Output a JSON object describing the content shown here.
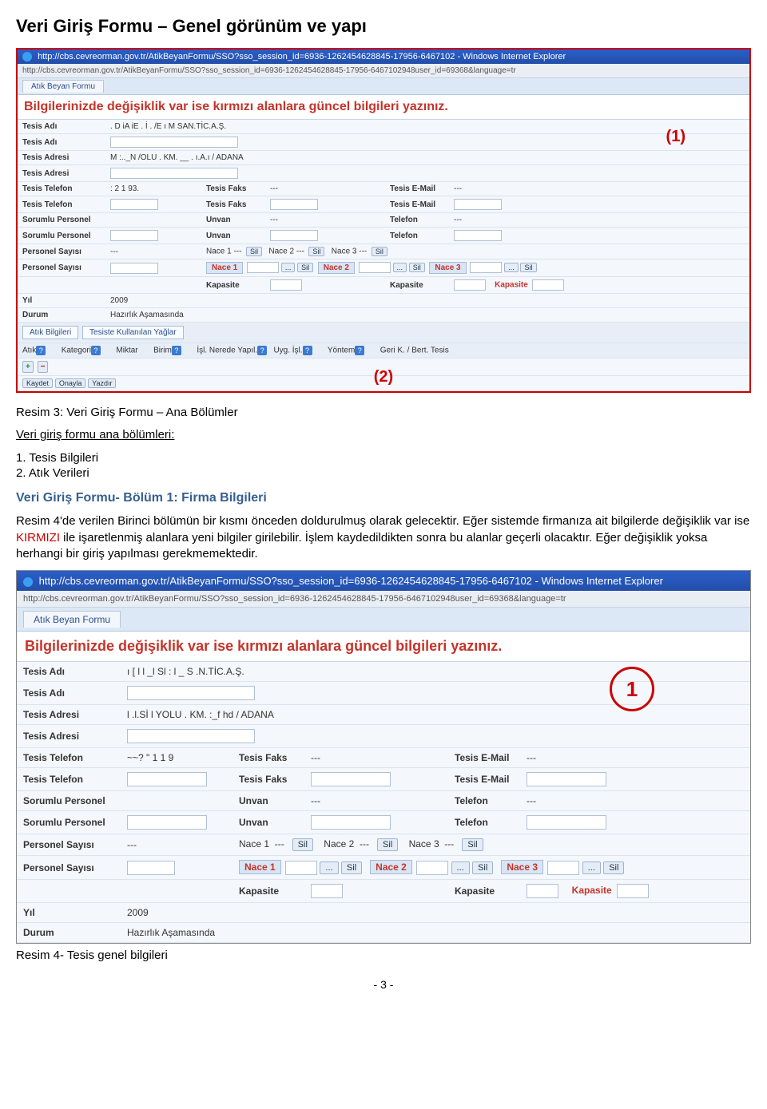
{
  "page": {
    "title": "Veri Giriş Formu – Genel görünüm ve yapı",
    "caption3": "Resim 3: Veri Giriş Formu – Ana Bölümler",
    "intro_sections": "Veri giriş formu ana bölümleri:",
    "sections": [
      "1. Tesis Bilgileri",
      "2. Atık Verileri"
    ],
    "h2": "Veri Giriş Formu- Bölüm 1: Firma Bilgileri",
    "para": {
      "p1a": "Resim 4'de verilen Birinci bölümün bir kısmı önceden doldurulmuş olarak gelecektir. Eğer sistemde firmanıza ait bilgilerde değişiklik var ise ",
      "p1_red": "KIRMIZI",
      "p1b": " ile işaretlenmiş alanlara yeni bilgiler girilebilir. İşlem kaydedildikten sonra bu alanlar geçerli olacaktır. Eğer değişiklik yoksa herhangi bir giriş yapılması gerekmemektedir."
    },
    "caption4": "Resim 4- Tesis genel bilgileri",
    "page_no": "- 3 -"
  },
  "markers": {
    "m1": "(1)",
    "m2": "(2)",
    "circle": "1"
  },
  "ie": {
    "title": "http://cbs.cevreorman.gov.tr/AtikBeyanFormu/SSO?sso_session_id=6936-1262454628845-17956-6467102 - Windows Internet Explorer",
    "addr": "http://cbs.cevreorman.gov.tr/AtikBeyanFormu/SSO?sso_session_id=6936-1262454628845-17956-6467102948user_id=69368&language=tr",
    "tab": "Atık Beyan Formu"
  },
  "form": {
    "instruction": "Bilgilerinizde değişiklik var ise kırmızı alanlara güncel bilgileri yazınız.",
    "labels": {
      "tesis_adi": "Tesis Adı",
      "tesis_adresi": "Tesis Adresi",
      "tesis_telefon": "Tesis Telefon",
      "tesis_faks": "Tesis Faks",
      "tesis_email": "Tesis E-Mail",
      "sorumlu": "Sorumlu Personel",
      "unvan": "Unvan",
      "telefon": "Telefon",
      "personel_sayisi": "Personel Sayısı",
      "nace1": "Nace 1",
      "nace2": "Nace 2",
      "nace3": "Nace 3",
      "kapasite": "Kapasite",
      "yil": "Yıl",
      "durum": "Durum"
    },
    "values": {
      "tesis_adi_s1": ". D   iA  iE . İ . /E ı   M SAN.TİC.A.Ş.",
      "tesis_adresi_s1": "M  :.._N /OLU    . KM. __ . ı.A.ı / ADANA",
      "tesis_telefon_s1": ": 2    1  93.",
      "yil": "2009",
      "durum": "Hazırlık Aşamasında",
      "dash": "---",
      "tesis_adi_s2": "ı  [  l  l  _l Sl  :  l  _   S  .N.TİC.A.Ş.",
      "tesis_adresi_s2": "l .l.Sİ l YOLU    . KM. :_f   hd / ADANA",
      "tesis_telefon_s2": "~~? \" 1   1  9"
    },
    "buttons": {
      "ellipsis": "...",
      "sil": "Sil",
      "kaydet": "Kaydet",
      "onayla": "Onayla",
      "yazdir": "Yazdır"
    },
    "subtabs": {
      "atik_bilgileri": "Atık Bilgileri",
      "tesiste_kullanilan": "Tesiste Kullanılan Yağlar"
    },
    "atik_headers": {
      "atik": "Atık",
      "kategori": "Kategori",
      "miktar": "Miktar",
      "birim": "Birim",
      "isl_nerede": "İşl. Nerede Yapıl.",
      "uyg_isl": "Uyg. İşl.",
      "yontem": "Yöntem",
      "geri_bert": "Geri K. / Bert. Tesis"
    }
  }
}
